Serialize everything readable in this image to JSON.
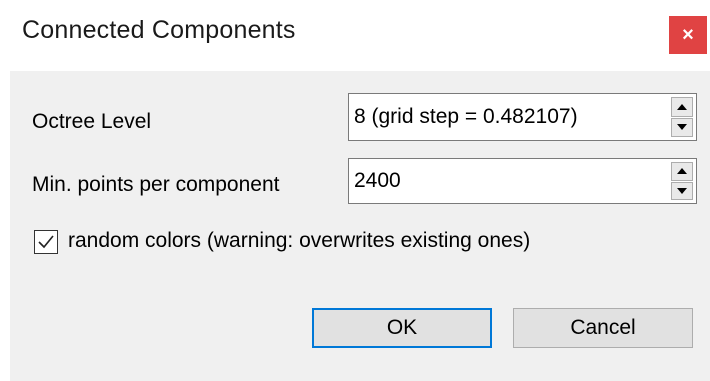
{
  "window": {
    "title": "Connected Components",
    "close_label": "×",
    "accent": "#e04343"
  },
  "octree": {
    "label": "Octree Level",
    "value": "8 (grid step = 0.482107)"
  },
  "min_points": {
    "label": "Min. points per component",
    "value": "2400"
  },
  "random_colors": {
    "label": "random colors (warning: overwrites existing ones)",
    "checked": true
  },
  "buttons": {
    "ok_label": "OK",
    "cancel_label": "Cancel",
    "default_accent": "#0078d7"
  }
}
